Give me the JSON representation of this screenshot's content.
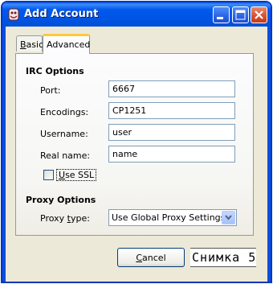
{
  "window": {
    "title": "Add Account"
  },
  "tabs": [
    {
      "label": "Basic",
      "accel": "B",
      "rest": "asic",
      "selected": false
    },
    {
      "label": "Advanced",
      "selected": true
    }
  ],
  "irc": {
    "section_title": "IRC Options",
    "port": {
      "label": "Port:",
      "value": "6667"
    },
    "encodings": {
      "label": "Encodings:",
      "value": "CP1251"
    },
    "username": {
      "label": "Username:",
      "value": "user"
    },
    "realname": {
      "label": "Real name:",
      "value": "name"
    },
    "use_ssl": {
      "label_accel": "U",
      "label_rest": "se SSL",
      "checked": false
    }
  },
  "proxy": {
    "section_title": "Proxy Options",
    "type_label": "Proxy type:",
    "type_label_pre": "Proxy ",
    "type_label_accel": "t",
    "type_label_post": "ype:",
    "type_value": "Use Global Proxy Settings"
  },
  "buttons": {
    "cancel_accel": "C",
    "cancel_rest": "ancel"
  },
  "caption": "Снимка 5",
  "colors": {
    "titlebar": "#0054e3",
    "dialog_bg": "#ece9d8",
    "tab_highlight": "#ffc83c"
  }
}
